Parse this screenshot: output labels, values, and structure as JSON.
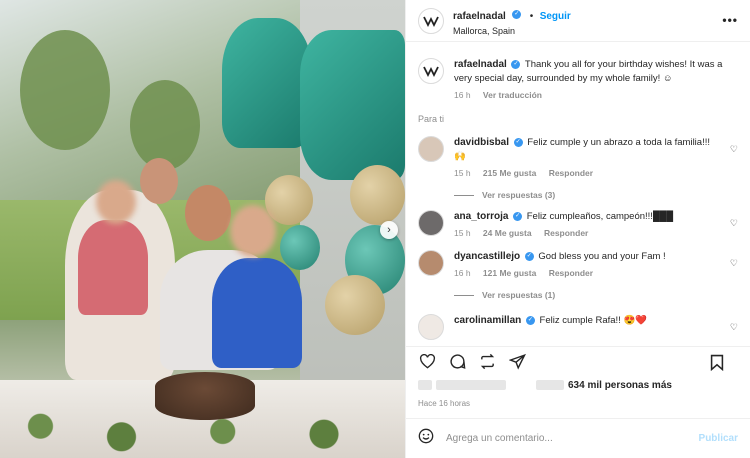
{
  "post": {
    "username": "rafaelnadal",
    "follow_label": "Seguir",
    "separator": "•",
    "location": "Mallorca, Spain",
    "more_label": "•••",
    "caption": "Thank you all for your birthday wishes! It was a very special day, surrounded by my whole family! ☺",
    "caption_time": "16 h",
    "translate_label": "Ver traducción",
    "para_ti": "Para ti"
  },
  "comments": [
    {
      "username": "davidbisbal",
      "text": "Feliz cumple y un abrazo a toda la familia!!! 🙌",
      "time": "15 h",
      "likes": "215 Me gusta",
      "reply": "Responder",
      "replies": "Ver respuestas (3)"
    },
    {
      "username": "ana_torroja",
      "text": "Feliz cumpleaños, campeón!!!███",
      "time": "15 h",
      "likes": "24 Me gusta",
      "reply": "Responder",
      "replies": ""
    },
    {
      "username": "dyancastillejo",
      "text": "God bless you and your Fam !",
      "time": "16 h",
      "likes": "121 Me gusta",
      "reply": "Responder",
      "replies": "Ver respuestas (1)"
    },
    {
      "username": "carolinamillan",
      "text": "Feliz cumple Rafa!! 😍❤️",
      "time": "",
      "likes": "",
      "reply": "",
      "replies": ""
    }
  ],
  "footer": {
    "likes_text": "634 mil personas más",
    "time_ago": "Hace 16 horas",
    "comment_placeholder": "Agrega un comentario...",
    "publish_label": "Publicar"
  },
  "icons": {
    "heart": "heart-icon",
    "comment": "comment-icon",
    "repost": "repost-icon",
    "share": "share-icon",
    "save": "bookmark-icon",
    "emoji": "emoji-icon",
    "next": "chevron-right-icon"
  },
  "colors": {
    "accent": "#0095f6",
    "verified": "#3897f0",
    "muted": "#8e8e8e"
  }
}
